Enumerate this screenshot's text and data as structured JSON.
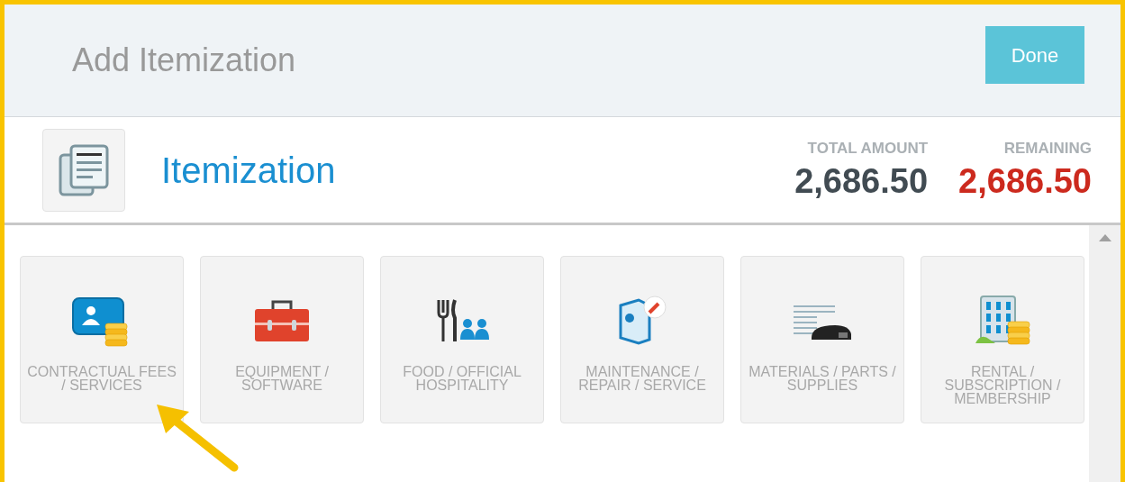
{
  "header": {
    "title": "Add Itemization",
    "done_button": "Done"
  },
  "summary": {
    "title": "Itemization",
    "total_label": "TOTAL AMOUNT",
    "total_value": "2,686.50",
    "remaining_label": "REMAINING",
    "remaining_value": "2,686.50"
  },
  "categories": [
    {
      "kind": "contract",
      "label": "CONTRACTUAL FEES / SERVICES"
    },
    {
      "kind": "toolbox",
      "label": "EQUIPMENT / SOFTWARE"
    },
    {
      "kind": "food",
      "label": "FOOD / OFFICIAL HOSPITALITY"
    },
    {
      "kind": "maintenance",
      "label": "MAINTENANCE / REPAIR / SERVICE"
    },
    {
      "kind": "materials",
      "label": "MATERIALS / PARTS / SUPPLIES"
    },
    {
      "kind": "rental",
      "label": "RENTAL / SUBSCRIPTION / MEMBERSHIP"
    }
  ]
}
